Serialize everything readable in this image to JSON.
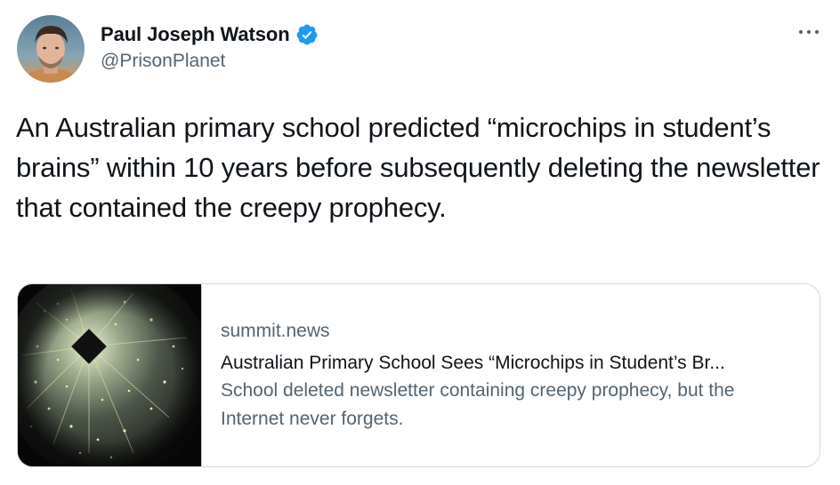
{
  "author": {
    "display_name": "Paul Joseph Watson",
    "handle": "@PrisonPlanet",
    "verified": true,
    "avatar_icon": "user-avatar-photo"
  },
  "tweet": {
    "text": "An Australian primary school predicted “microchips in student’s brains” within 10 years before subsequently deleting the newsletter that contained the creepy prophecy."
  },
  "card": {
    "image_icon": "microchip-brain-image",
    "domain": "summit.news",
    "title": "Australian Primary School Sees “Microchips in Student’s Br...",
    "description": "School deleted newsletter containing creepy prophecy, but the Internet never forgets."
  },
  "icons": {
    "verified": "verified-badge-icon",
    "more": "more-options-icon"
  },
  "colors": {
    "verified_blue": "#1d9bf0",
    "secondary_text": "#536471",
    "primary_text": "#0f1419",
    "border": "#cfd9de"
  }
}
